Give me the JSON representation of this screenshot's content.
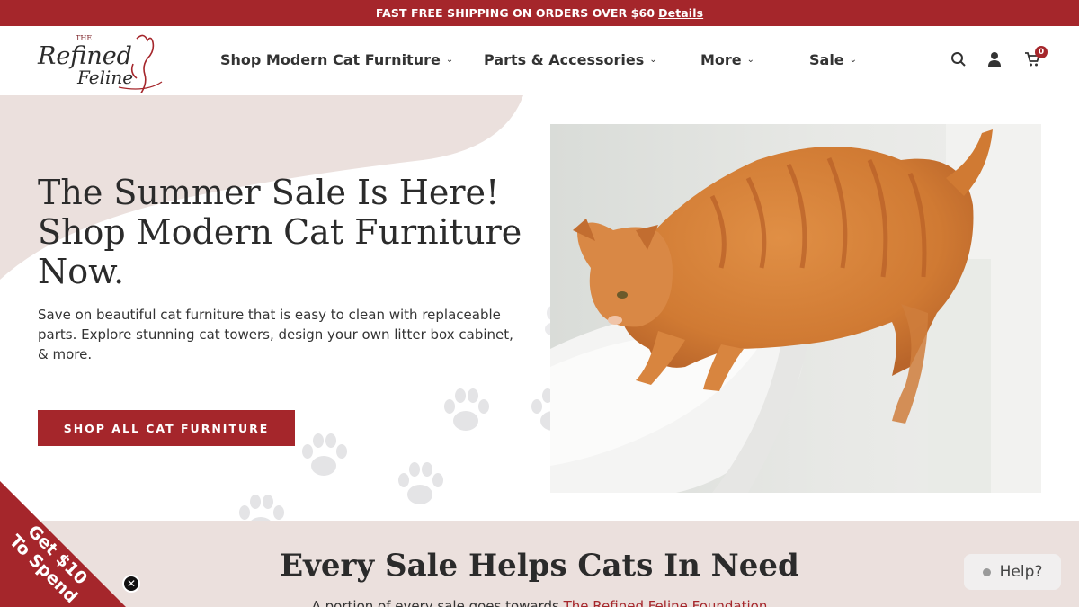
{
  "announcement": {
    "text": "FAST FREE SHIPPING ON ORDERS OVER $60",
    "link_label": "Details"
  },
  "header": {
    "logo_text_top": "THE",
    "logo_text_main": "Refined",
    "logo_text_sub": "Feline",
    "nav": [
      {
        "label": "Shop Modern Cat Furniture"
      },
      {
        "label": "Parts & Accessories"
      },
      {
        "label": "More"
      },
      {
        "label": "Sale"
      }
    ],
    "icons": [
      "search-icon",
      "account-icon",
      "cart-icon"
    ],
    "cart_count": "0"
  },
  "hero": {
    "title_lines": [
      "The Summer Sale Is Here!",
      "Shop Modern Cat Furniture",
      "Now."
    ],
    "description": "Save on beautiful cat furniture that is easy to clean with replaceable parts. Explore stunning cat towers, design your own litter box cabinet, & more.",
    "button_label": "SHOP ALL CAT FURNITURE"
  },
  "foundation": {
    "title": "Every Sale Helps Cats In Need",
    "text_start": "A portion of every sale goes towards",
    "link_label": "The Refined Feline Foundation"
  },
  "promo": {
    "line1": "Get $10",
    "line2": "To Spend"
  },
  "help": {
    "label": "Help?"
  },
  "colors": {
    "brand_red": "#a5262b",
    "blush": "#ebe0dd"
  }
}
